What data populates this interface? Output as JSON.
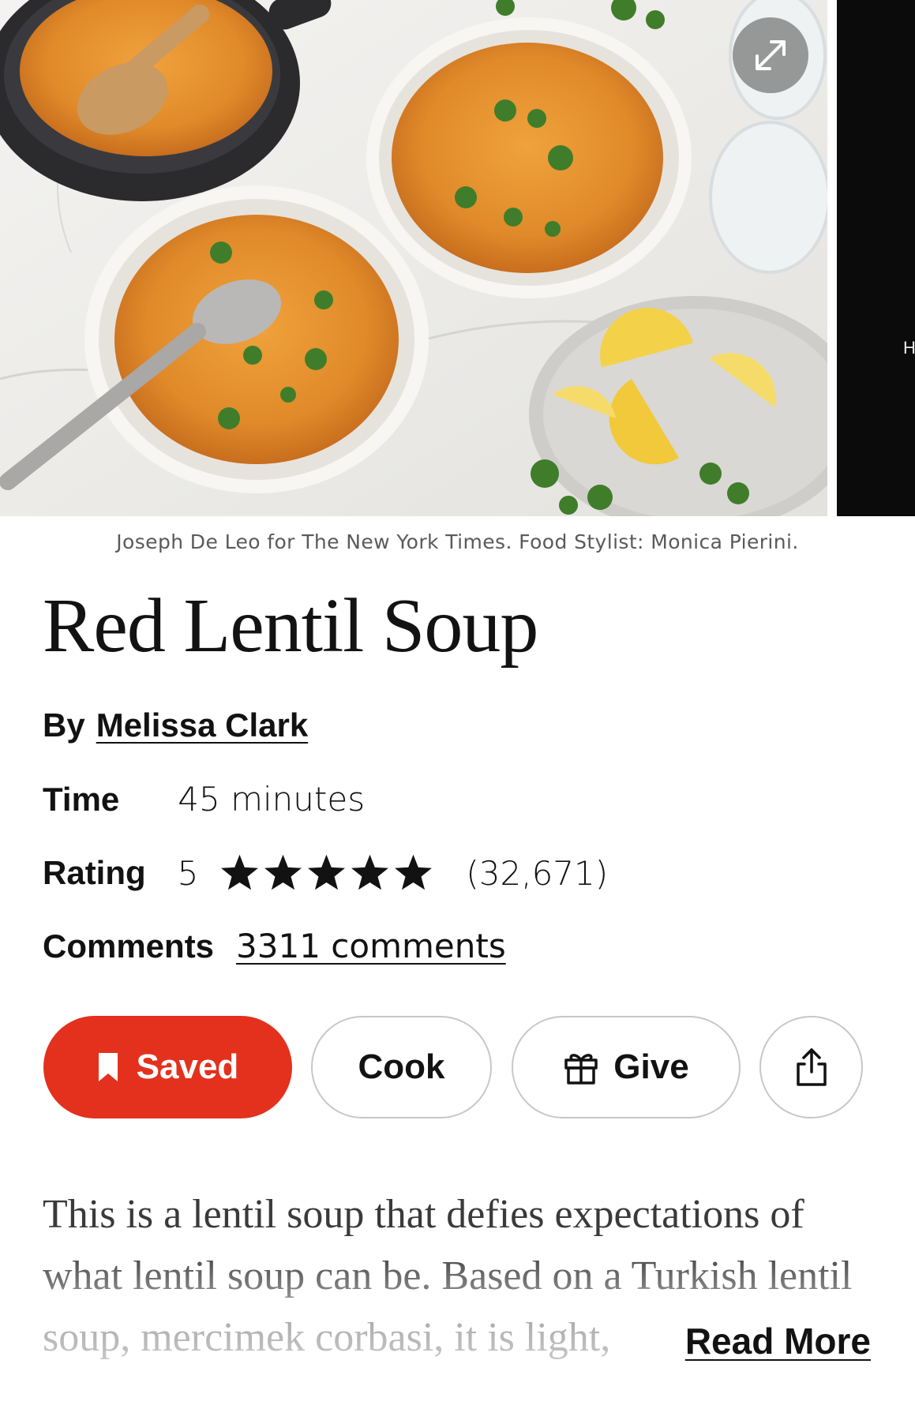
{
  "hero": {
    "next_image_peek_text": "H",
    "expand_icon": "expand-arrows-icon"
  },
  "caption": "Joseph De Leo for The New York Times. Food Stylist: Monica Pierini.",
  "recipe": {
    "title": "Red Lentil Soup",
    "byline_prefix": "By",
    "author": "Melissa Clark",
    "time_label": "Time",
    "time_value": "45 minutes",
    "rating_label": "Rating",
    "rating_value": "5",
    "rating_stars": 5,
    "rating_count": "(32,671)",
    "comments_label": "Comments",
    "comments_link": "3311 comments"
  },
  "actions": {
    "saved_label": "Saved",
    "cook_label": "Cook",
    "give_label": "Give",
    "share_icon": "share-icon",
    "saved_color": "#e3311d"
  },
  "description": {
    "text": "This is a lentil soup that defies expectations of what lentil soup can be. Based on a Turkish lentil soup, mercimek corbasi, it is light,",
    "read_more_label": "Read More"
  }
}
